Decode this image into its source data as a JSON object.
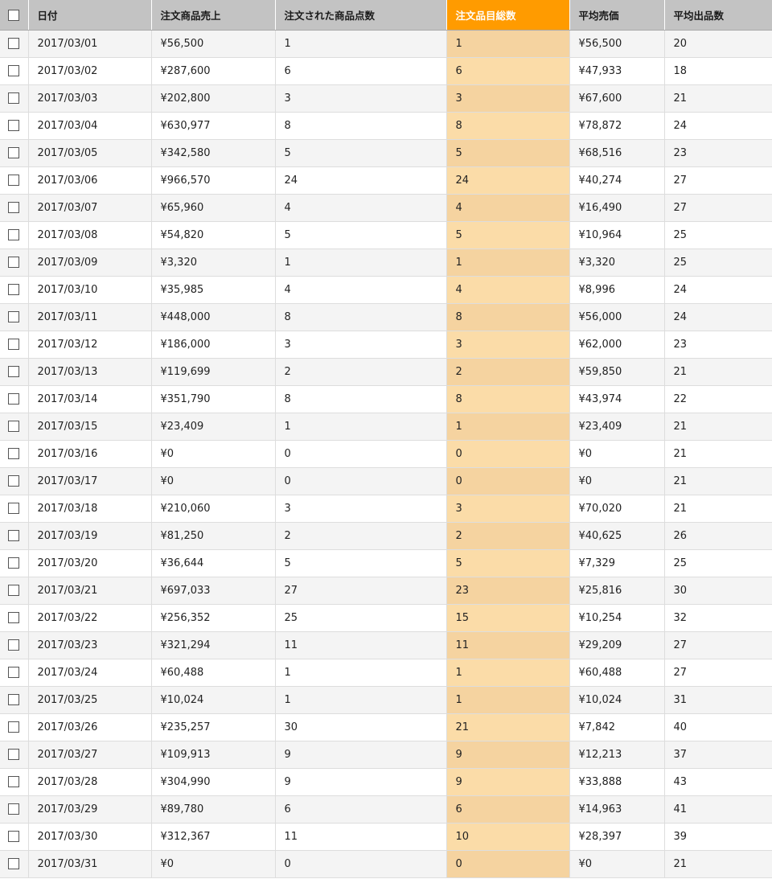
{
  "table": {
    "columns": [
      "日付",
      "注文商品売上",
      "注文された商品点数",
      "注文品目総数",
      "平均売価",
      "平均出品数"
    ],
    "highlight_column": 3,
    "colors": {
      "header_bg": "#c3c3c3",
      "highlight_header": "#ff9b00",
      "highlight_cell": "#fbdca8",
      "row_alt": "#f4f4f4"
    },
    "rows": [
      [
        "2017/03/01",
        "¥56,500",
        "1",
        "1",
        "¥56,500",
        "20"
      ],
      [
        "2017/03/02",
        "¥287,600",
        "6",
        "6",
        "¥47,933",
        "18"
      ],
      [
        "2017/03/03",
        "¥202,800",
        "3",
        "3",
        "¥67,600",
        "21"
      ],
      [
        "2017/03/04",
        "¥630,977",
        "8",
        "8",
        "¥78,872",
        "24"
      ],
      [
        "2017/03/05",
        "¥342,580",
        "5",
        "5",
        "¥68,516",
        "23"
      ],
      [
        "2017/03/06",
        "¥966,570",
        "24",
        "24",
        "¥40,274",
        "27"
      ],
      [
        "2017/03/07",
        "¥65,960",
        "4",
        "4",
        "¥16,490",
        "27"
      ],
      [
        "2017/03/08",
        "¥54,820",
        "5",
        "5",
        "¥10,964",
        "25"
      ],
      [
        "2017/03/09",
        "¥3,320",
        "1",
        "1",
        "¥3,320",
        "25"
      ],
      [
        "2017/03/10",
        "¥35,985",
        "4",
        "4",
        "¥8,996",
        "24"
      ],
      [
        "2017/03/11",
        "¥448,000",
        "8",
        "8",
        "¥56,000",
        "24"
      ],
      [
        "2017/03/12",
        "¥186,000",
        "3",
        "3",
        "¥62,000",
        "23"
      ],
      [
        "2017/03/13",
        "¥119,699",
        "2",
        "2",
        "¥59,850",
        "21"
      ],
      [
        "2017/03/14",
        "¥351,790",
        "8",
        "8",
        "¥43,974",
        "22"
      ],
      [
        "2017/03/15",
        "¥23,409",
        "1",
        "1",
        "¥23,409",
        "21"
      ],
      [
        "2017/03/16",
        "¥0",
        "0",
        "0",
        "¥0",
        "21"
      ],
      [
        "2017/03/17",
        "¥0",
        "0",
        "0",
        "¥0",
        "21"
      ],
      [
        "2017/03/18",
        "¥210,060",
        "3",
        "3",
        "¥70,020",
        "21"
      ],
      [
        "2017/03/19",
        "¥81,250",
        "2",
        "2",
        "¥40,625",
        "26"
      ],
      [
        "2017/03/20",
        "¥36,644",
        "5",
        "5",
        "¥7,329",
        "25"
      ],
      [
        "2017/03/21",
        "¥697,033",
        "27",
        "23",
        "¥25,816",
        "30"
      ],
      [
        "2017/03/22",
        "¥256,352",
        "25",
        "15",
        "¥10,254",
        "32"
      ],
      [
        "2017/03/23",
        "¥321,294",
        "11",
        "11",
        "¥29,209",
        "27"
      ],
      [
        "2017/03/24",
        "¥60,488",
        "1",
        "1",
        "¥60,488",
        "27"
      ],
      [
        "2017/03/25",
        "¥10,024",
        "1",
        "1",
        "¥10,024",
        "31"
      ],
      [
        "2017/03/26",
        "¥235,257",
        "30",
        "21",
        "¥7,842",
        "40"
      ],
      [
        "2017/03/27",
        "¥109,913",
        "9",
        "9",
        "¥12,213",
        "37"
      ],
      [
        "2017/03/28",
        "¥304,990",
        "9",
        "9",
        "¥33,888",
        "43"
      ],
      [
        "2017/03/29",
        "¥89,780",
        "6",
        "6",
        "¥14,963",
        "41"
      ],
      [
        "2017/03/30",
        "¥312,367",
        "11",
        "10",
        "¥28,397",
        "39"
      ],
      [
        "2017/03/31",
        "¥0",
        "0",
        "0",
        "¥0",
        "21"
      ]
    ]
  }
}
